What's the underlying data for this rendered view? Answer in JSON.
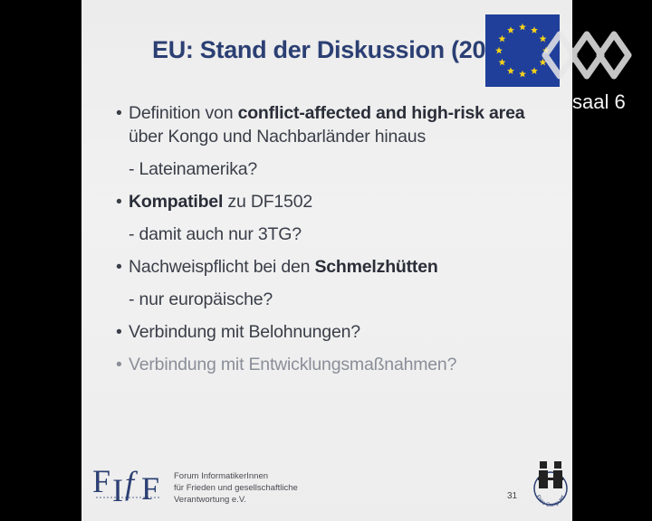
{
  "slide": {
    "title": "EU: Stand der Diskussion (2014)",
    "bullets": [
      {
        "kind": "main",
        "parts": [
          {
            "text": "Definition von "
          },
          {
            "text": "conflict-affected and high-risk area",
            "bold": true
          }
        ]
      },
      {
        "kind": "sub",
        "parts": [
          {
            "text": "über Kongo und Nachbarländer hinaus"
          }
        ]
      },
      {
        "kind": "sub",
        "gap": true,
        "parts": [
          {
            "text": "- Lateinamerika?"
          }
        ]
      },
      {
        "kind": "main",
        "gap": true,
        "parts": [
          {
            "text": "Kompatibel",
            "bold": true
          },
          {
            "text": " zu DF1502"
          }
        ]
      },
      {
        "kind": "sub",
        "gap": true,
        "parts": [
          {
            "text": "- damit auch nur 3TG?"
          }
        ]
      },
      {
        "kind": "main",
        "gap": true,
        "parts": [
          {
            "text": "Nachweispflicht bei den "
          },
          {
            "text": "Schmelzhütten",
            "bold": true
          }
        ]
      },
      {
        "kind": "sub",
        "gap": true,
        "parts": [
          {
            "text": "- nur europäische?"
          }
        ]
      },
      {
        "kind": "main",
        "gap": true,
        "parts": [
          {
            "text": "Verbindung mit Belohnungen?"
          }
        ]
      },
      {
        "kind": "main",
        "gap": true,
        "faded": true,
        "parts": [
          {
            "text": "Verbindung mit Entwicklungsmaßnahmen?"
          }
        ]
      }
    ],
    "footer": {
      "org_lines": [
        "Forum InformatikerInnen",
        "für Frieden und gesellschaftliche",
        "Verantwortung e.V."
      ],
      "page_number": "31",
      "fiff_logo": "FIfF",
      "fc_logo_text": "Faire Computer"
    },
    "flag_icon": "eu-flag-icon"
  },
  "overlay": {
    "channel_label": "saal 6",
    "channel_icon": "ccc-channel-logo-icon"
  },
  "colors": {
    "title": "#2b3f73",
    "text": "#3a3e48",
    "faded_text": "#8a8e98",
    "flag_blue": "#1f3f9a",
    "flag_star": "#f6d21a",
    "background": "#000000"
  }
}
